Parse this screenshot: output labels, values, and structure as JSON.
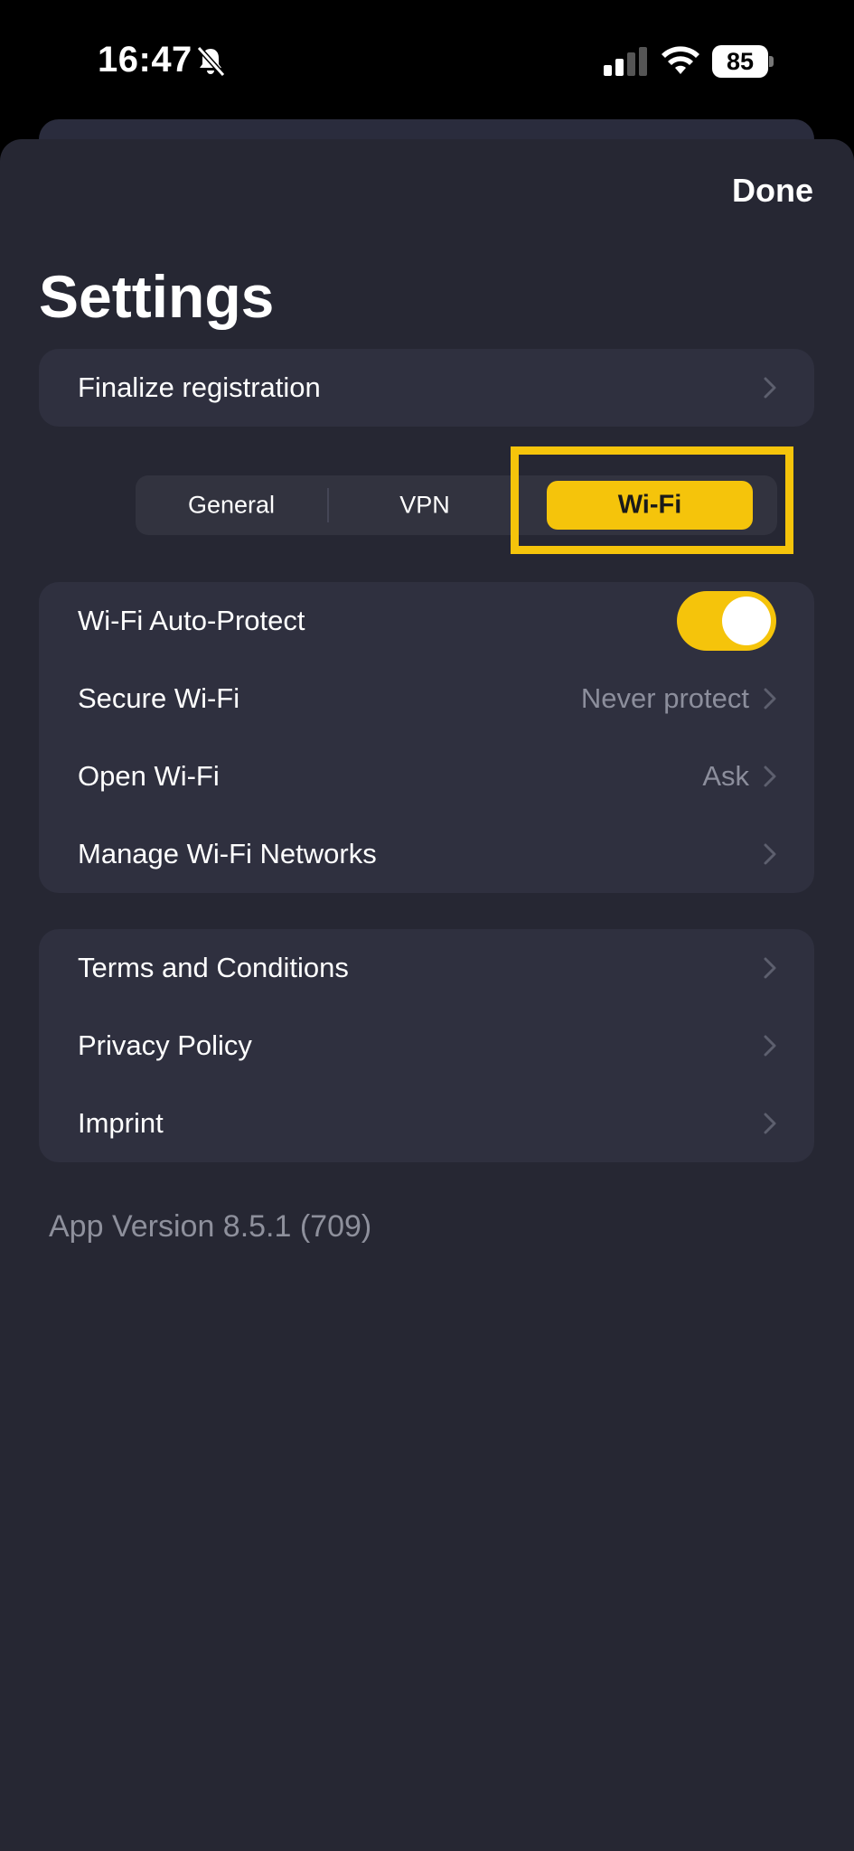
{
  "status_bar": {
    "time": "16:47",
    "battery": "85",
    "icons": [
      "bell-slash-icon",
      "signal-icon",
      "wifi-icon",
      "battery-icon"
    ]
  },
  "header": {
    "done_label": "Done",
    "title": "Settings"
  },
  "registration": {
    "label": "Finalize registration"
  },
  "tabs": {
    "items": [
      "General",
      "VPN",
      "Wi-Fi"
    ],
    "selected": "Wi-Fi"
  },
  "wifi_section": {
    "auto_protect": {
      "label": "Wi-Fi Auto-Protect",
      "enabled": true
    },
    "secure_wifi": {
      "label": "Secure Wi-Fi",
      "value": "Never protect"
    },
    "open_wifi": {
      "label": "Open Wi-Fi",
      "value": "Ask"
    },
    "manage_networks": {
      "label": "Manage Wi-Fi Networks"
    }
  },
  "legal_section": {
    "terms": "Terms and Conditions",
    "privacy": "Privacy Policy",
    "imprint": "Imprint"
  },
  "footer": {
    "app_version": "App Version 8.5.1 (709)"
  },
  "colors": {
    "accent": "#f5c40b",
    "background": "#262733",
    "card": "#2f303f",
    "secondary_text": "#8c8e9c"
  }
}
